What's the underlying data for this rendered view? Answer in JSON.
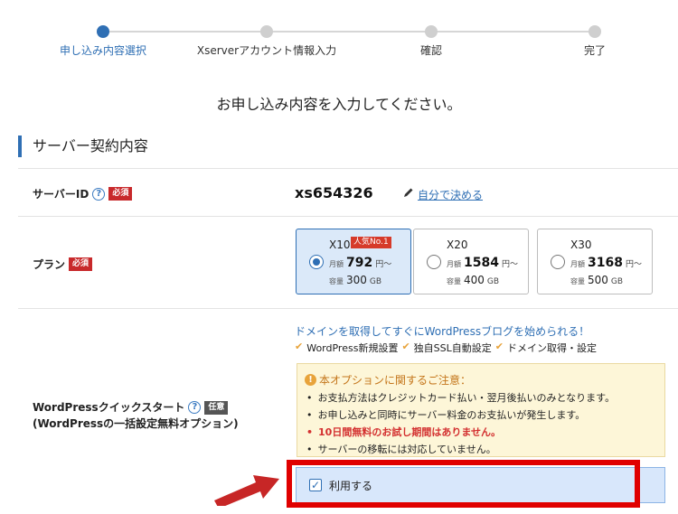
{
  "stepper": {
    "steps": [
      {
        "label": "申し込み内容選択",
        "active": true
      },
      {
        "label": "Xserverアカウント情報入力",
        "active": false
      },
      {
        "label": "確認",
        "active": false
      },
      {
        "label": "完了",
        "active": false
      }
    ]
  },
  "intro": "お申し込み内容を入力してください。",
  "section_title": "サーバー契約内容",
  "server_id": {
    "label": "サーバーID",
    "required_badge": "必須",
    "value": "xs654326",
    "link": "自分で決める"
  },
  "plan": {
    "label": "プラン",
    "required_badge": "必須",
    "monthly_label": "月額",
    "capacity_label": "容量",
    "price_unit": "円〜",
    "options": [
      {
        "name": "X10",
        "badge": "人気No.1",
        "price": "792",
        "capacity": "300",
        "capacity_unit": "GB",
        "selected": true
      },
      {
        "name": "X20",
        "badge": "",
        "price": "1584",
        "capacity": "400",
        "capacity_unit": "GB",
        "selected": false
      },
      {
        "name": "X30",
        "badge": "",
        "price": "3168",
        "capacity": "500",
        "capacity_unit": "GB",
        "selected": false
      }
    ]
  },
  "wp_quick": {
    "label_line1": "WordPressクイックスタート",
    "optional_badge": "任意",
    "label_line2": "(WordPressの一括設定無料オプション)",
    "promo": "ドメインを取得してすぐにWordPressブログを始められる！",
    "features": [
      "WordPress新規設置",
      "独自SSL自動設定",
      "ドメイン取得・設定"
    ],
    "notice_title": "本オプションに関するご注意：",
    "notices": [
      "お支払方法はクレジットカード払い・翌月後払いのみとなります。",
      "お申し込みと同時にサーバー料金のお支払いが発生します。",
      "10日間無料のお試し期間はありません。",
      "サーバーの移転には対応していません。"
    ],
    "use_label": "利用する",
    "use_checked": true
  },
  "colors": {
    "accent": "#2f6fb4",
    "required": "#c8292b",
    "highlight": "#e00000",
    "notice_bg": "#fdf6d8"
  }
}
